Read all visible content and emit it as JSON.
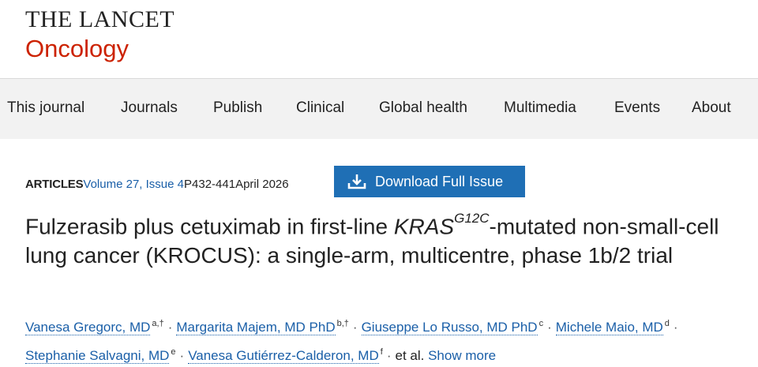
{
  "masthead": {
    "line1": "THE LANCET",
    "line2": "Oncology"
  },
  "nav": {
    "items": [
      "This journal",
      "Journals",
      "Publish",
      "Clinical",
      "Global health",
      "Multimedia",
      "Events",
      "About"
    ]
  },
  "article_meta": {
    "section": "ARTICLES",
    "issue": "Volume 27, Issue 4",
    "pages": "P432-441",
    "date": "April 2026"
  },
  "download": {
    "label": "Download Full Issue",
    "icon": "download-icon"
  },
  "title": {
    "part1": "Fulzerasib plus cetuximab in first-line ",
    "gene": "KRAS",
    "mutation": "G12C",
    "part2": "-mutated non-small-cell lung cancer (KROCUS): a single-arm, multicentre, phase 1b/2 trial"
  },
  "authors": {
    "list": [
      {
        "name": "Vanesa Gregorc, MD",
        "aff": "a,†"
      },
      {
        "name": "Margarita Majem, MD PhD",
        "aff": "b,†"
      },
      {
        "name": "Giuseppe Lo Russo, MD PhD",
        "aff": "c"
      },
      {
        "name": "Michele Maio, MD",
        "aff": "d"
      },
      {
        "name": "Stephanie Salvagni, MD",
        "aff": "e"
      },
      {
        "name": "Vanesa Gutiérrez-Calderon, MD",
        "aff": "f"
      }
    ],
    "separator": "·",
    "et_al": "et al.",
    "show_more": "Show more"
  },
  "colors": {
    "brand_red": "#cc2200",
    "link_blue": "#1a5fa8",
    "button_blue": "#1f6fb5",
    "nav_bg": "#f2f2f2"
  }
}
